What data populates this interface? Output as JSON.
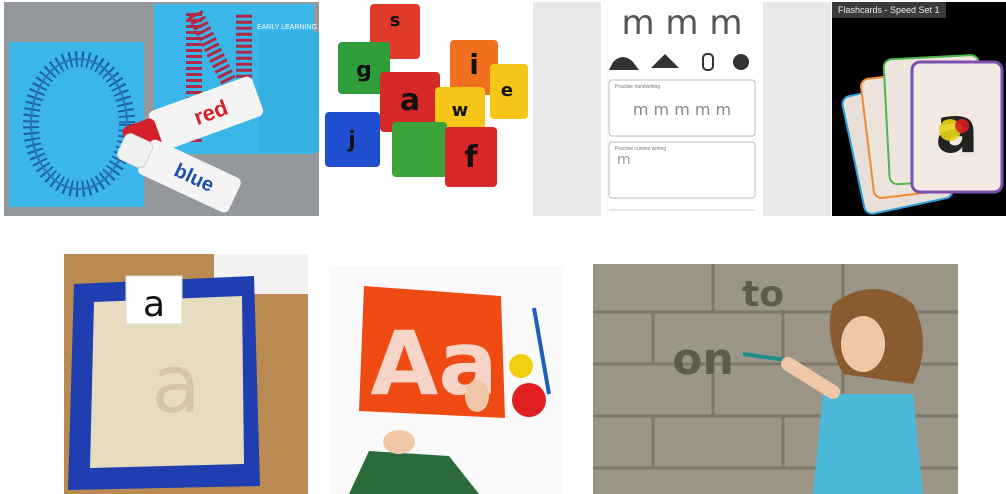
{
  "grid": {
    "items": [
      {
        "id": "dot-marker-letters",
        "marker_red": "red",
        "marker_blue": "blue",
        "brand": "EARLY LEARNING",
        "letter_left": "O",
        "letter_right": "N"
      },
      {
        "id": "letter-cubes",
        "faces": [
          "i",
          "a",
          "g",
          "f",
          "w",
          "e",
          "s",
          "j"
        ]
      },
      {
        "id": "handwriting-worksheet",
        "letters": "m m m",
        "practice_title": "Practise handwriting",
        "practice_letters": "m m m m m",
        "second_title": "Practise cursive writing",
        "second_letter": "m"
      },
      {
        "id": "flashcards",
        "label": "Flashcards - Speed Set 1",
        "card_letter": "a"
      },
      {
        "id": "sand-tray",
        "card_letter": "a",
        "sand_letter": "a"
      },
      {
        "id": "paint-resist",
        "letters": "Aa"
      },
      {
        "id": "water-wall",
        "wall_text_1": "to",
        "wall_text_2": "on"
      }
    ]
  },
  "colors": {
    "cyan": "#3ab7e8",
    "marker_red": "#d4202a",
    "marker_blue": "#1c4fa8",
    "tray_blue": "#1f3eb0",
    "sand": "#e8dcc0",
    "paint_orange": "#ef4a14",
    "brick": "#9a9586"
  }
}
